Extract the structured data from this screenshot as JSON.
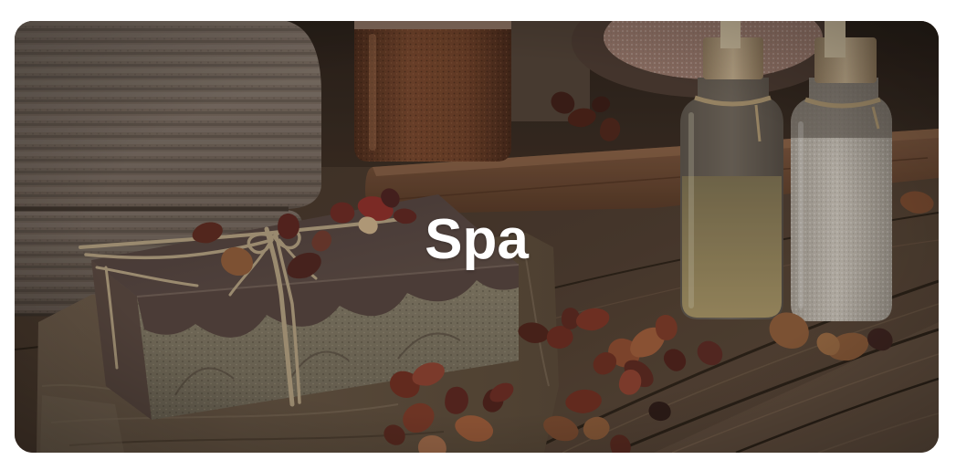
{
  "card": {
    "title": "Spa"
  },
  "colors": {
    "page_background": "#ffffff",
    "title_text": "#ffffff",
    "image_overlay": "#140e0a"
  }
}
